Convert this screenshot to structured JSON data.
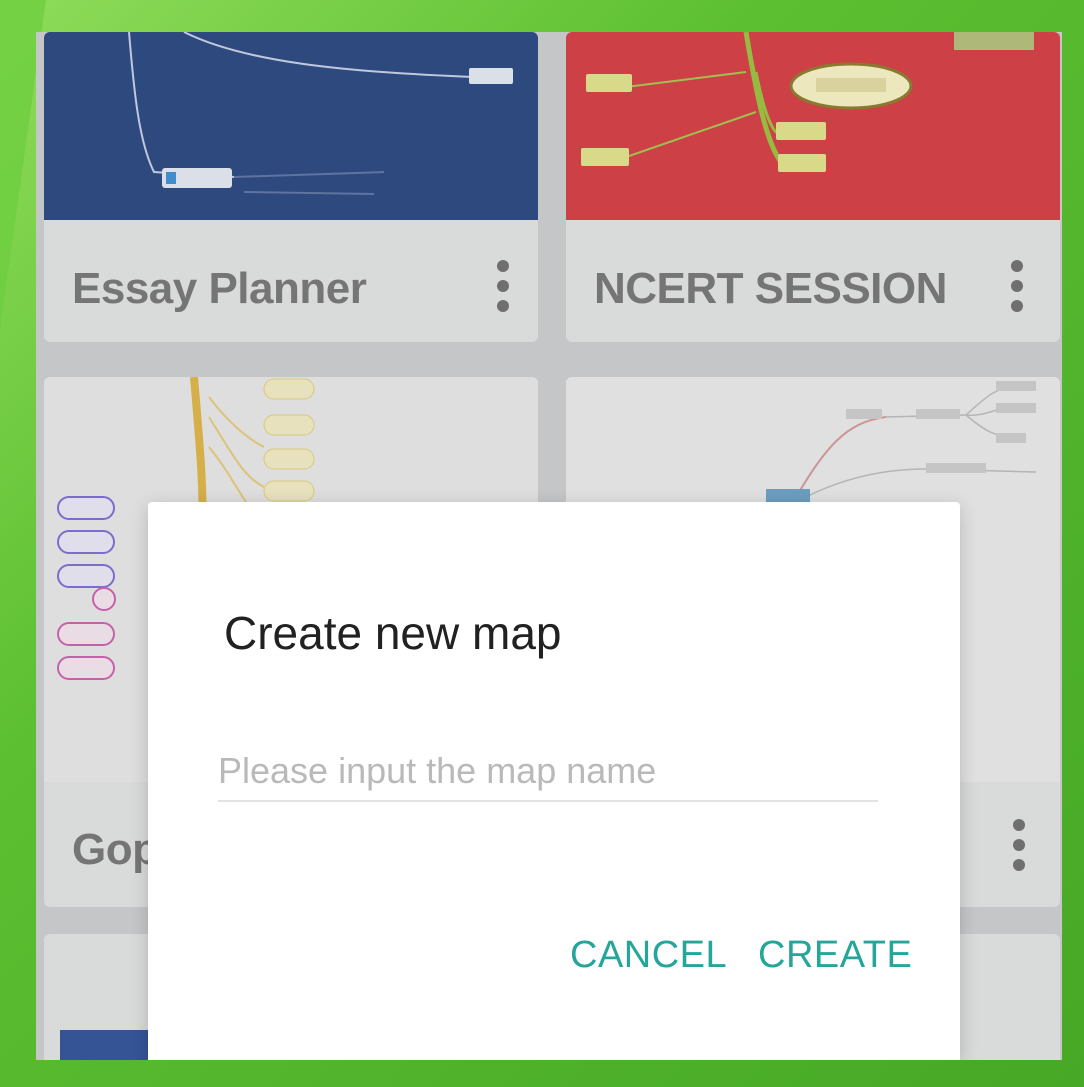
{
  "cards": [
    {
      "title": "Essay Planner",
      "thumb_color": "#23427e"
    },
    {
      "title": "NCERT SESSION",
      "thumb_color": "#d9383f"
    },
    {
      "title": "Gop",
      "thumb_color": "#ececec"
    },
    {
      "title": "",
      "thumb_color": "#eeeeee"
    }
  ],
  "dialog": {
    "title": "Create new map",
    "input_placeholder": "Please input the map name",
    "input_value": "",
    "cancel_label": "CANCEL",
    "create_label": "CREATE"
  },
  "colors": {
    "frame": "#4fb52c",
    "accent": "#26a69a"
  }
}
